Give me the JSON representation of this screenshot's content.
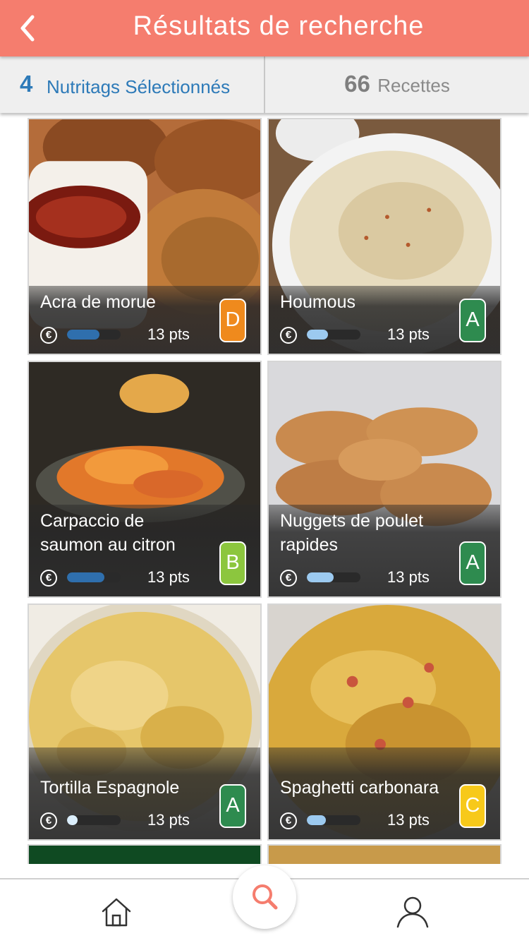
{
  "header": {
    "title": "Résultats de recherche",
    "back_icon": "chevron-left-icon"
  },
  "filters": {
    "nutritags_count": "4",
    "nutritags_label": "Nutritags Sélectionnés",
    "recipes_count": "66",
    "recipes_label": "Recettes"
  },
  "recipes": [
    {
      "name": "Acra de morue",
      "points": "13 pts",
      "grade": "D",
      "grade_color": "#ef8a1d",
      "cost_level": 0.6,
      "cost_color": "#2f6fad"
    },
    {
      "name": "Houmous",
      "points": "13 pts",
      "grade": "A",
      "grade_color": "#2e8b4f",
      "cost_level": 0.4,
      "cost_color": "#9ccaf0"
    },
    {
      "name": "Carpaccio de saumon au citron",
      "points": "13 pts",
      "grade": "B",
      "grade_color": "#8cc63e",
      "cost_level": 0.7,
      "cost_color": "#2f6fad"
    },
    {
      "name": "Nuggets de poulet rapides",
      "points": "13 pts",
      "grade": "A",
      "grade_color": "#2e8b4f",
      "cost_level": 0.5,
      "cost_color": "#9ccaf0"
    },
    {
      "name": "Tortilla Espagnole",
      "points": "13 pts",
      "grade": "A",
      "grade_color": "#2e8b4f",
      "cost_level": 0.2,
      "cost_color": "#dbeefc"
    },
    {
      "name": "Spaghetti carbonara",
      "points": "13 pts",
      "grade": "C",
      "grade_color": "#f7c91a",
      "cost_level": 0.35,
      "cost_color": "#9ccaf0"
    }
  ],
  "nav": {
    "home_icon": "home-icon",
    "search_icon": "search-icon",
    "profile_icon": "user-icon"
  },
  "colors": {
    "header": "#f57d6e",
    "accent_blue": "#2d7ab8"
  }
}
